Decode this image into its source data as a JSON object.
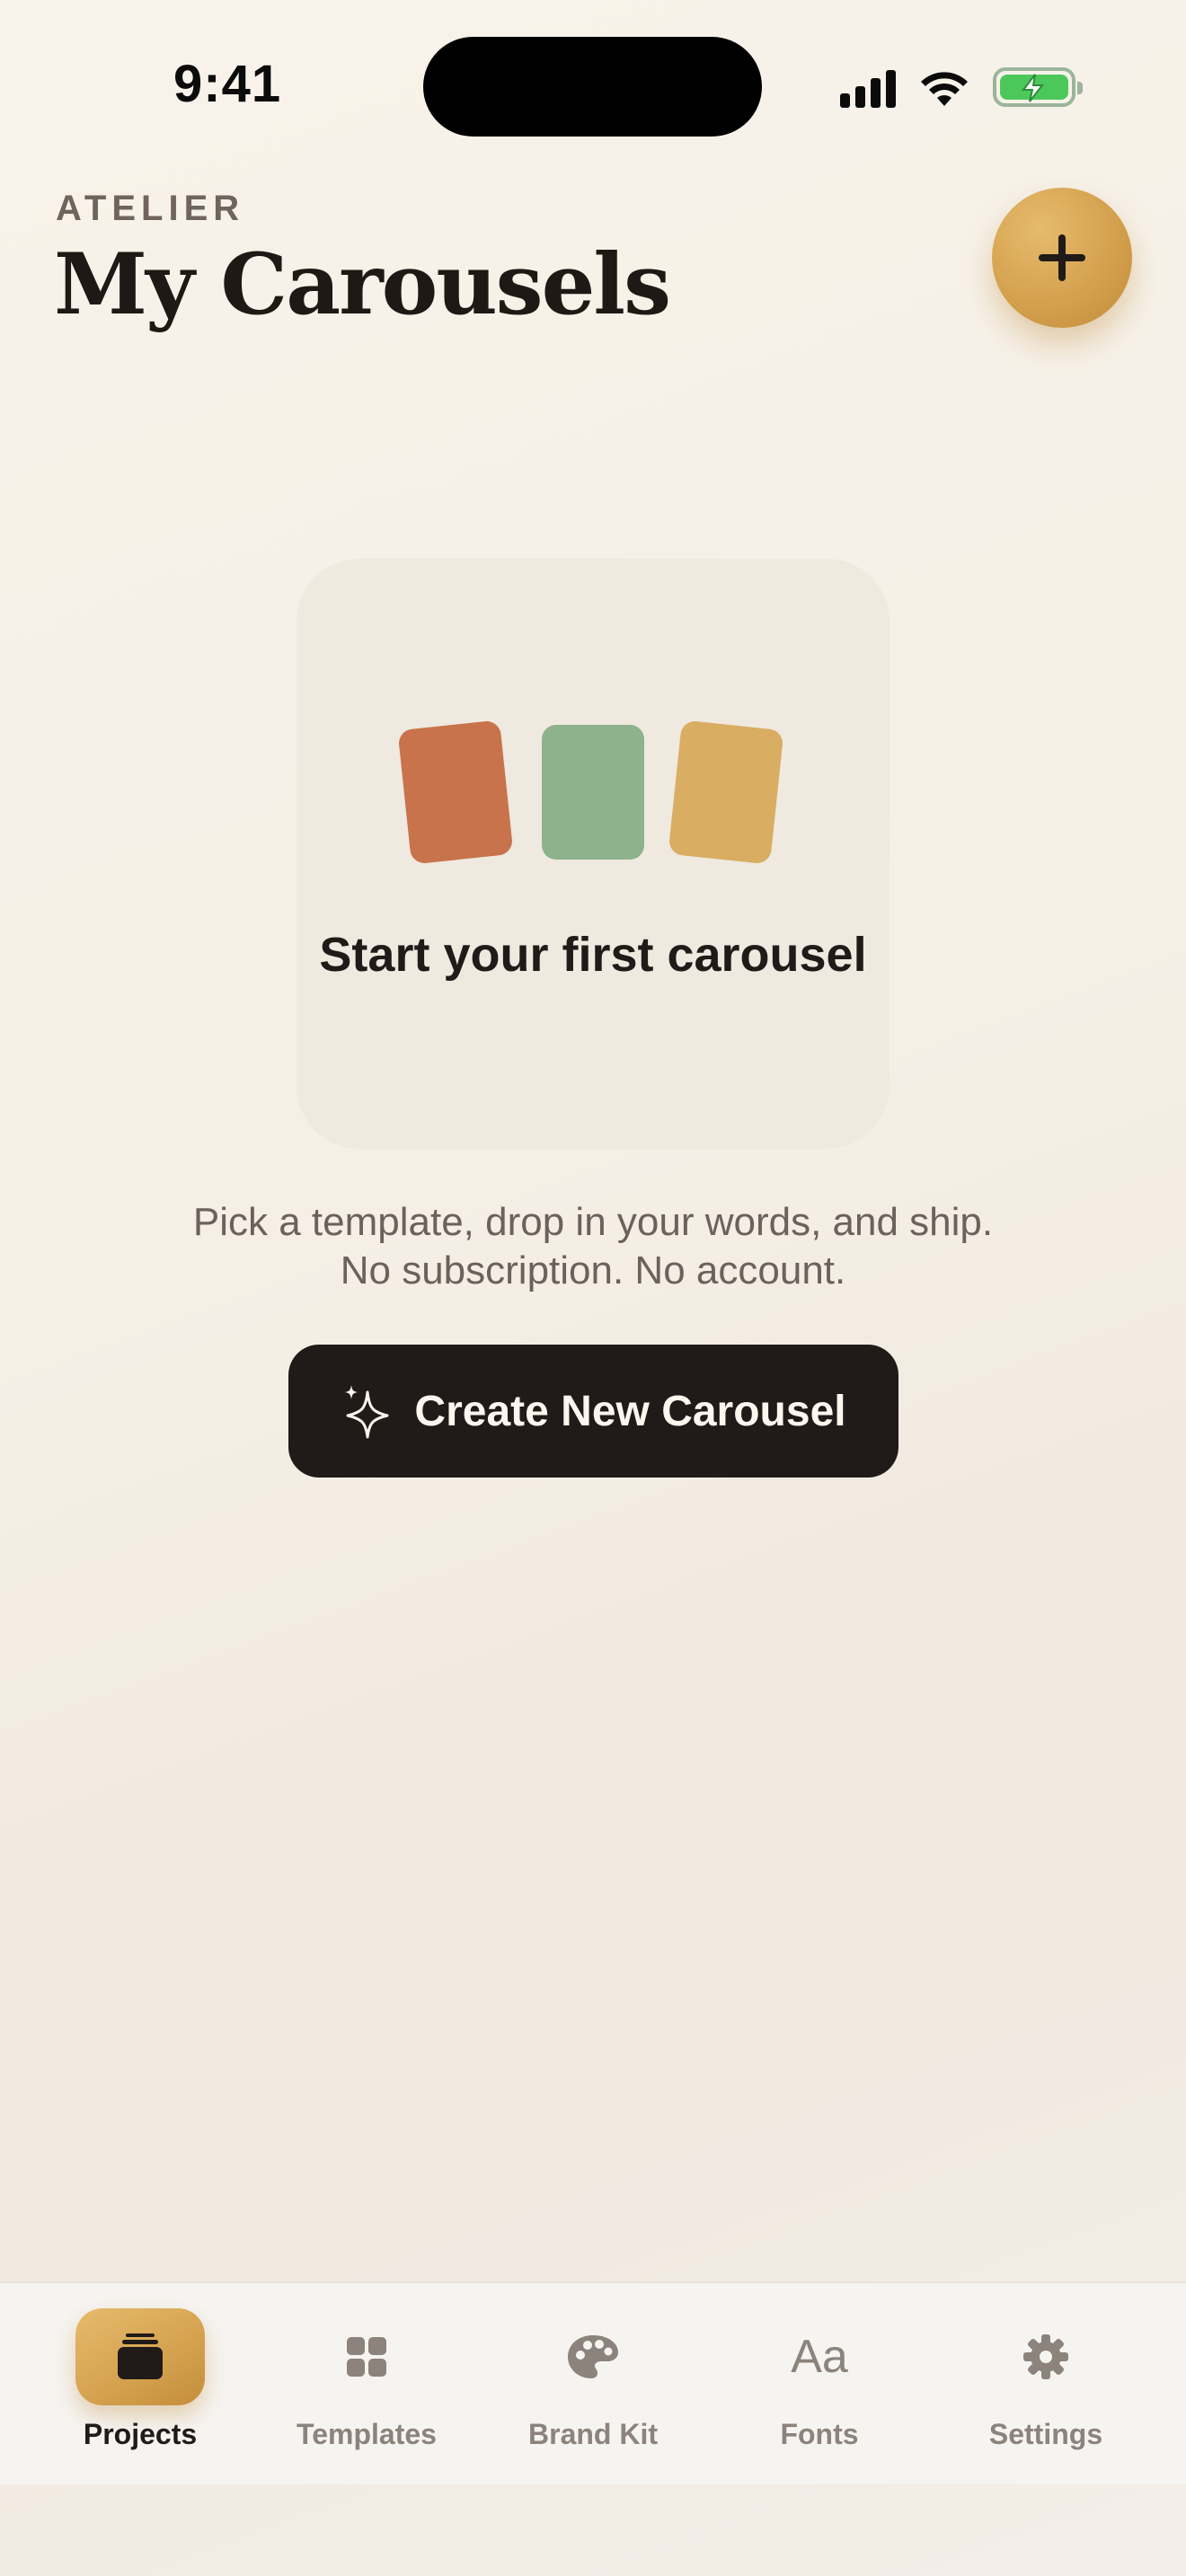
{
  "status_bar": {
    "time": "9:41"
  },
  "header": {
    "eyebrow": "ATELIER",
    "title": "My Carousels"
  },
  "empty_state": {
    "title": "Start your first carousel",
    "subtitle_line1": "Pick a template, drop in your words, and ship.",
    "subtitle_line2": "No subscription. No account.",
    "tile_colors": [
      "#c8734b",
      "#8db28c",
      "#d9ad62"
    ]
  },
  "cta": {
    "label": "Create New Carousel",
    "icon": "sparkles-icon"
  },
  "tabs": [
    {
      "label": "Projects",
      "icon": "stack-icon",
      "active": true
    },
    {
      "label": "Templates",
      "icon": "grid-icon",
      "active": false
    },
    {
      "label": "Brand Kit",
      "icon": "palette-icon",
      "active": false
    },
    {
      "label": "Fonts",
      "icon": "aa-icon",
      "glyph": "Aa",
      "active": false
    },
    {
      "label": "Settings",
      "icon": "gear-icon",
      "active": false
    }
  ],
  "colors": {
    "accent": "#d4a14e",
    "ink": "#201b18",
    "muted": "#8b837c"
  }
}
